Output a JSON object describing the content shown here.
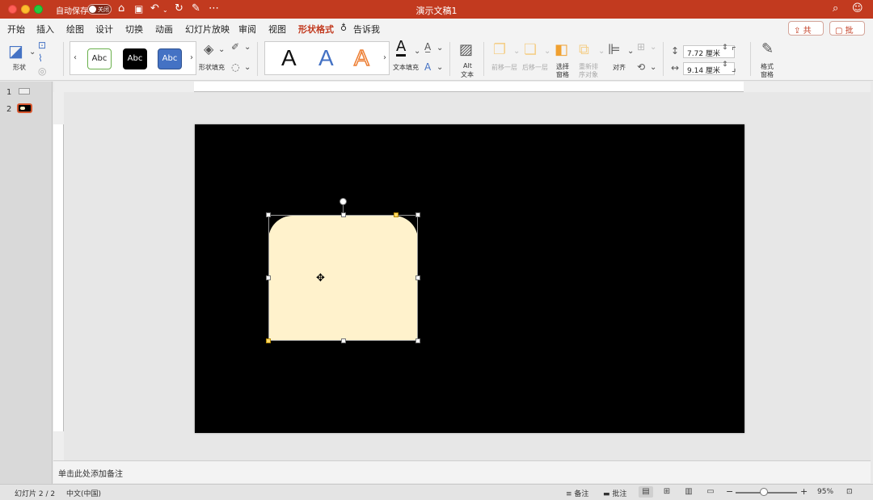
{
  "titlebar": {
    "autosave_label": "自动保存",
    "autosave_state": "关闭",
    "doc_title": "演示文稿1"
  },
  "menu": {
    "tabs": [
      "开始",
      "插入",
      "绘图",
      "设计",
      "切换",
      "动画",
      "幻灯片放映",
      "审阅",
      "视图",
      "形状格式"
    ],
    "tell_me": "告诉我",
    "active_tab": "形状格式",
    "share": "共享",
    "comment": "批注"
  },
  "ribbon": {
    "shapes_label": "形状",
    "style_samples": [
      "Abc",
      "Abc",
      "Abc"
    ],
    "shape_fill_label": "形状填充",
    "wordart_samples": [
      "A",
      "A",
      "A"
    ],
    "text_fill_label": "文本填充",
    "alt_text_label_1": "Alt",
    "alt_text_label_2": "文本",
    "bring_forward": "前移一层",
    "send_backward": "后移一层",
    "selection_pane_1": "选择",
    "selection_pane_2": "窗格",
    "reorder_1": "重新排",
    "reorder_2": "序对象",
    "align": "对齐",
    "height_value": "7.72 厘米",
    "width_value": "9.14 厘米",
    "format_pane_1": "格式",
    "format_pane_2": "窗格"
  },
  "thumbnails": {
    "slide1_num": "1",
    "slide2_num": "2"
  },
  "notes": {
    "placeholder": "单击此处添加备注"
  },
  "statusbar": {
    "slide_info": "幻灯片 2 / 2",
    "language": "中文(中国)",
    "notes_btn": "备注",
    "comments_btn": "批注",
    "zoom": "95%"
  },
  "colors": {
    "brand": "#c23a1f",
    "shape_fill": "#fff2cc",
    "slide_bg": "#000000"
  }
}
